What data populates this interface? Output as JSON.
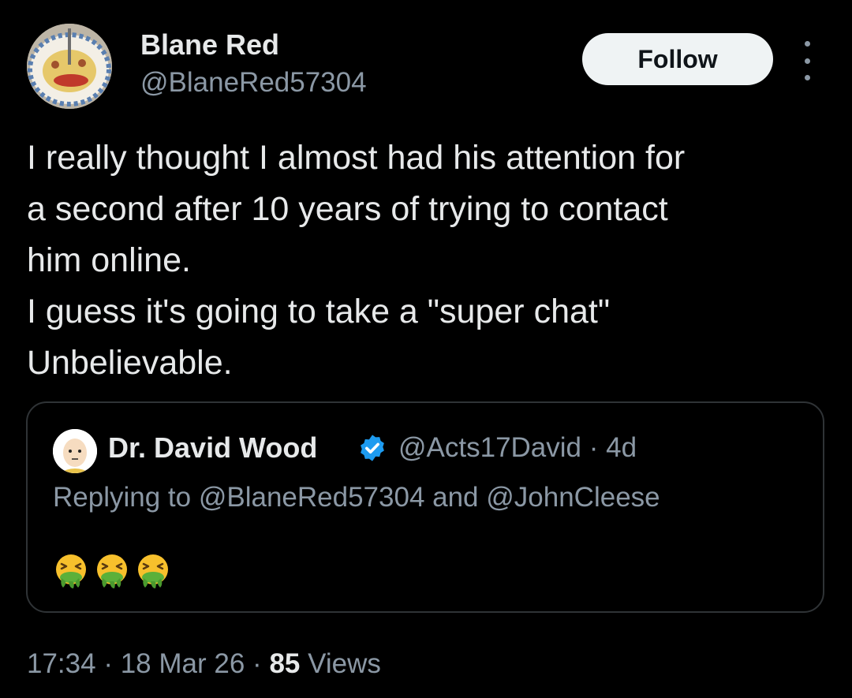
{
  "author": {
    "name": "Blane Red",
    "handle": "@BlaneRed57304",
    "avatar_icon": "pizza-plate-avatar"
  },
  "follow_label": "Follow",
  "more_icon": "more-vertical-icon",
  "tweet_lines": [
    "I really thought I almost had his attention for",
    "a second after 10 years of trying to contact",
    "him online.",
    "I guess it's going to take a \"super chat\"",
    "Unbelievable."
  ],
  "quote": {
    "name": "Dr. David Wood",
    "verified_icon": "verified-badge-icon",
    "verified_color": "#1d9bf0",
    "handle": "@Acts17David",
    "separator": "·",
    "age": "4d",
    "reply_text": "Replying to @BlaneRed57304 and @JohnCleese",
    "emoji_icon": "vomiting-face-emoji",
    "emoji_count": 3
  },
  "meta": {
    "time": "17:34",
    "separator": "·",
    "date": "18 Mar 26",
    "views_count": "85",
    "views_label": "Views"
  },
  "colors": {
    "background": "#000000",
    "text_primary": "#e7e9ea",
    "text_secondary": "#8b98a5",
    "border": "#2f3336",
    "follow_bg": "#eff3f4"
  }
}
